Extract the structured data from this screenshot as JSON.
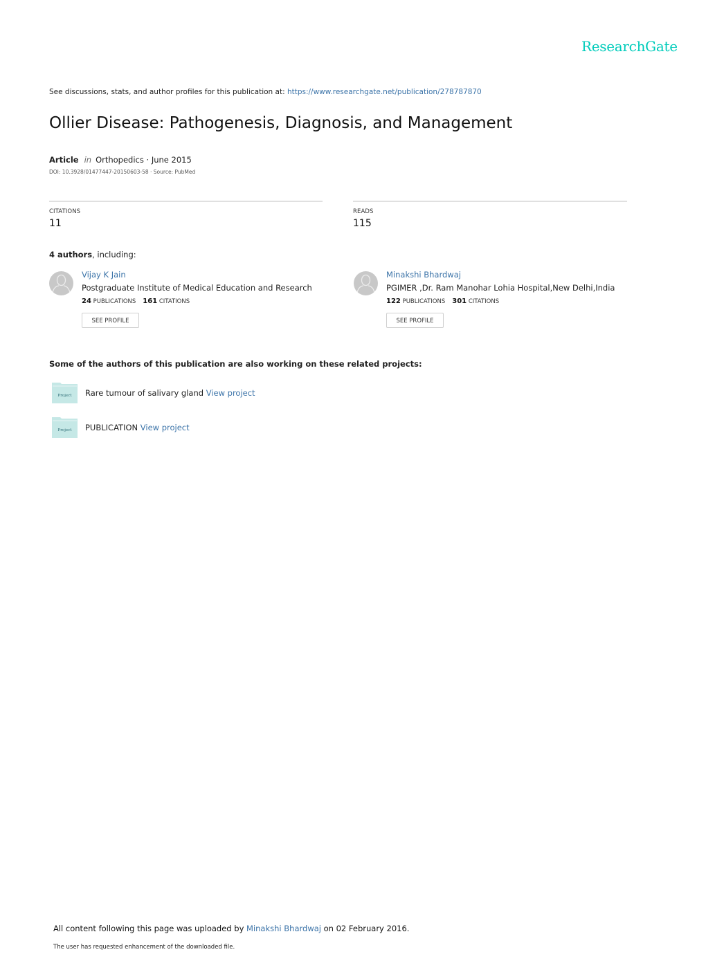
{
  "header": {
    "logo": "ResearchGate",
    "discussion_prefix": "See discussions, stats, and author profiles for this publication at: ",
    "publication_url": "https://www.researchgate.net/publication/278787870"
  },
  "publication": {
    "title": "Ollier Disease: Pathogenesis, Diagnosis, and Management",
    "type": "Article",
    "in_label": "in",
    "journal_date": "Orthopedics · June 2015",
    "doi_source": "DOI: 10.3928/01477447-20150603-58 · Source: PubMed"
  },
  "stats": {
    "citations_label": "CITATIONS",
    "citations_value": "11",
    "reads_label": "READS",
    "reads_value": "115"
  },
  "authors": {
    "count_label": "4 authors",
    "including_label": ", including:",
    "list": [
      {
        "name": "Vijay K Jain",
        "institution": "Postgraduate Institute of Medical Education and Research",
        "publications": "24",
        "publications_label": "PUBLICATIONS",
        "citations": "161",
        "citations_label": "CITATIONS",
        "button": "SEE PROFILE"
      },
      {
        "name": "Minakshi Bhardwaj",
        "institution": "PGIMER ,Dr. Ram Manohar Lohia Hospital,New Delhi,India",
        "publications": "122",
        "publications_label": "PUBLICATIONS",
        "citations": "301",
        "citations_label": "CITATIONS",
        "button": "SEE PROFILE"
      }
    ]
  },
  "projects": {
    "heading": "Some of the authors of this publication are also working on these related projects:",
    "icon_label": "Project",
    "items": [
      {
        "name": "Rare tumour of salivary gland",
        "link": "View project"
      },
      {
        "name": "PUBLICATION",
        "link": "View project"
      }
    ]
  },
  "footer": {
    "upload_prefix": "All content following this page was uploaded by ",
    "uploader": "Minakshi Bhardwaj",
    "upload_suffix": " on 02 February 2016.",
    "enhancement_note": "The user has requested enhancement of the downloaded file."
  },
  "colors": {
    "brand": "#00ccbb",
    "link": "#3b73a8",
    "project_icon": "#c5e8e6"
  }
}
